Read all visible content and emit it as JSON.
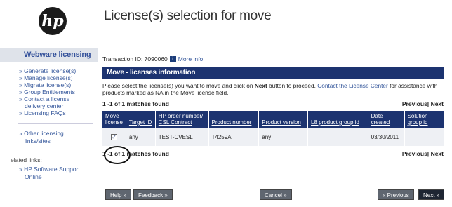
{
  "logo": {
    "text": "hp"
  },
  "page_title": "License(s) selection for move",
  "sidebar": {
    "heading": "Webware licensing",
    "items": [
      {
        "label": "» Generate license(s)"
      },
      {
        "label": "» Manage license(s)"
      },
      {
        "label": "» Migrate license(s)"
      },
      {
        "label": "» Group Entitlements"
      },
      {
        "label": "» Contact a license",
        "continuation": "delivery center"
      },
      {
        "label": "» Licensing FAQs"
      }
    ],
    "other_line1": "» Other licensing",
    "other_line2": "links/sites",
    "related_label": "elated links:",
    "related_line1": "» HP Software Support",
    "related_line2": "Online"
  },
  "main": {
    "transaction_label": "Transaction ID: 7090060",
    "info_icon": "i",
    "more_info": "More info",
    "section_title": "Move - licenses information",
    "instructions_part1": "Please select the license(s) you want to move and click on ",
    "instructions_bold": "Next",
    "instructions_part2": " button to proceed. ",
    "instructions_link": "Contact the License Center",
    "instructions_part3": " for assistance with products marked as NA in the Move license field.",
    "matches_top": "1 -1 of 1 matches found",
    "matches_bottom": "1 -1 of 1 matches found",
    "pager_previous": "Previous|",
    "pager_next": "Next"
  },
  "table": {
    "headers": {
      "move": "Move license",
      "target": "Target ID",
      "order": "HP order number/ CSL Contract",
      "product": "Product number",
      "version": "Product version",
      "l8": "L8 product group id",
      "date": "Date created",
      "solution": "Solution group id"
    },
    "row": {
      "checked_mark": "✓",
      "target": "any",
      "order": "TEST-CVESL",
      "product": "T4259A",
      "version": "any",
      "l8": "",
      "date": "03/30/2011",
      "solution": ""
    }
  },
  "buttons": {
    "help": "Help »",
    "feedback": "Feedback »",
    "cancel": "Cancel »",
    "previous": "« Previous",
    "next": "Next »"
  }
}
